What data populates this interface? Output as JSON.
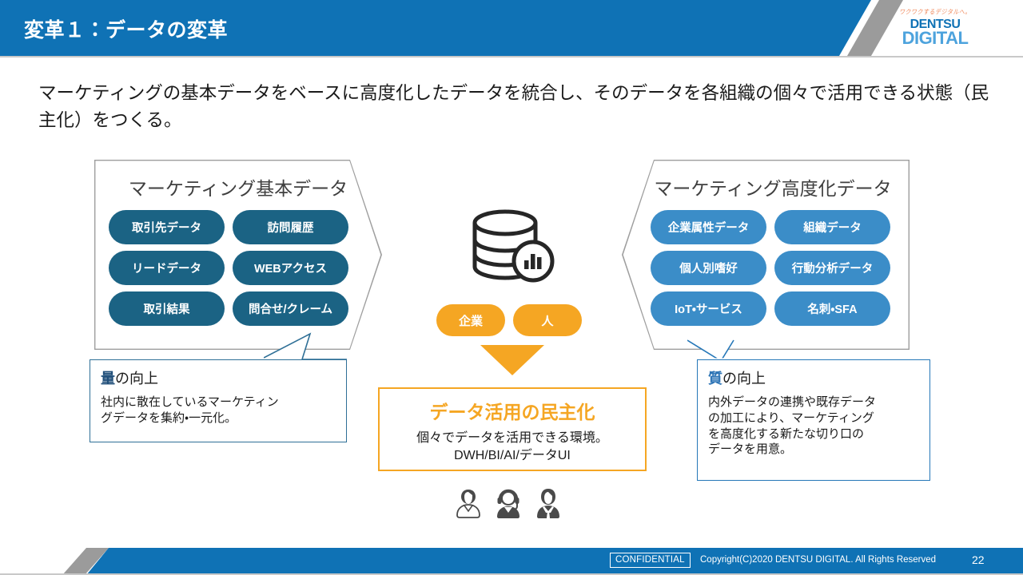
{
  "header": {
    "title": "変革１：データの変革",
    "band_color": "#0f72b5",
    "stripe_color": "#9b9b9b"
  },
  "logo": {
    "tagline": "ワクワクするデジタルへ。",
    "line1": "DENTSU",
    "line2": "DIGITAL",
    "tagline_color": "#f08a5d",
    "line1_color": "#0f72b5",
    "line2_color": "#4da3dd"
  },
  "lead": {
    "text": "マーケティングの基本データをベースに高度化したデータを統合し、そのデータを各組織の個々で活用できる状態（民主化）をつくる。"
  },
  "left_panel": {
    "title": "マーケティング基本データ",
    "pill_color": "#1b6384",
    "pills": [
      "取引先データ",
      "訪問履歴",
      "リードデータ",
      "WEBアクセス",
      "取引結果",
      "問合せ/クレーム"
    ]
  },
  "right_panel": {
    "title": "マーケティング高度化データ",
    "pill_color": "#3b8dc8",
    "pills": [
      "企業属性データ",
      "組織データ",
      "個人別嗜好",
      "行動分析データ",
      "IoT・サービス",
      "名刺・SFA"
    ]
  },
  "center": {
    "icon": "database-chart-icon",
    "pills": [
      "企業",
      "人"
    ],
    "pill_color": "#f5a623",
    "arrow": "down-arrow",
    "box": {
      "title": "データ活用の民主化",
      "body_line1": "個々でデータを活用できる環境。",
      "body_line2": "DWH/BI/AI/データUI",
      "accent_color": "#f5a623"
    }
  },
  "callout_left": {
    "keyword": "量",
    "head_rest": "の向上",
    "body_line1": "社内に散在しているマーケティン",
    "body_line2": "グデータを集約・一元化。",
    "border_color": "#2e6f96",
    "keyword_color": "#1f4e79"
  },
  "callout_right": {
    "keyword": "質",
    "head_rest": "の向上",
    "body_line1": "内外データの連携や既存データ",
    "body_line2": "の加工により、マーケティング",
    "body_line3": "を高度化する新たな切り口の",
    "body_line4": "データを用意。",
    "border_color": "#2577b8",
    "keyword_color": "#2e75b6"
  },
  "people": {
    "icons": [
      "person-outline-icon",
      "person-headset-icon",
      "person-suit-icon"
    ]
  },
  "footer": {
    "confidential": "CONFIDENTIAL",
    "copyright": "Copyright(C)2020 DENTSU DIGITAL. All Rights Reserved",
    "page_number": "22",
    "band_color": "#0f72b5"
  }
}
